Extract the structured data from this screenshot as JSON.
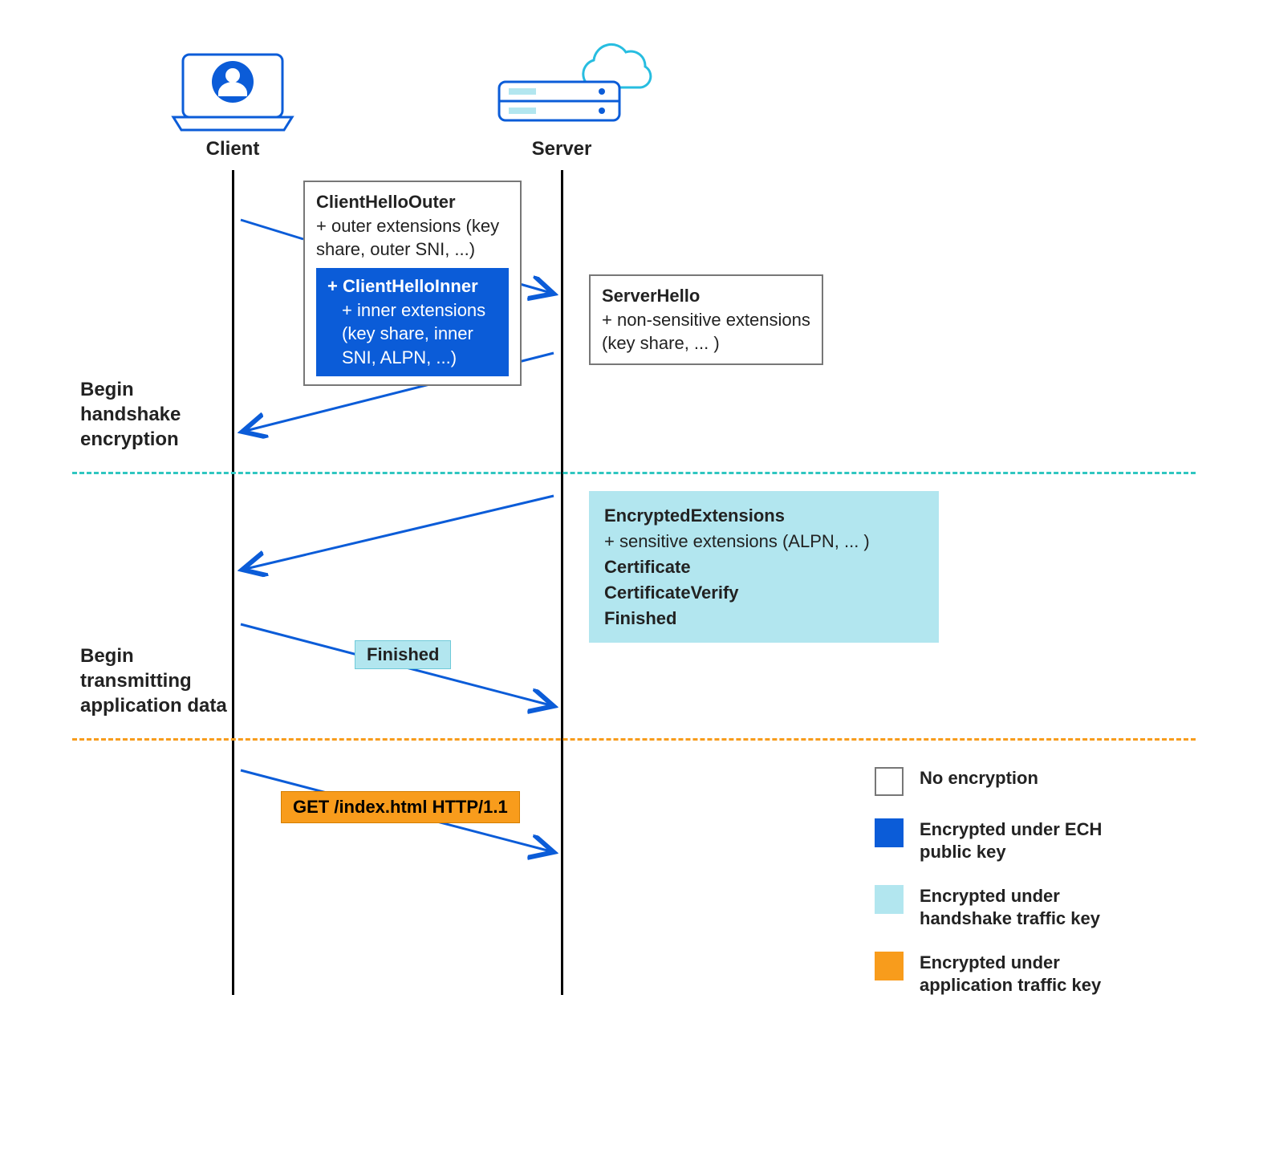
{
  "actors": {
    "client": "Client",
    "server": "Server"
  },
  "m1": {
    "title": "ClientHelloOuter",
    "detail": "+ outer extensions (key share, outer SNI, ...)",
    "inner_title": "+ ClientHelloInner",
    "inner_detail": "+ inner extensions (key share, inner SNI, ALPN, ...)"
  },
  "m2": {
    "title": "ServerHello",
    "detail": "+ non-sensitive extensions (key share, ... )"
  },
  "m3": {
    "l1": "EncryptedExtensions",
    "l2": "+ sensitive extensions (ALPN, ... )",
    "l3": "Certificate",
    "l4": "CertificateVerify",
    "l5": "Finished"
  },
  "m4": {
    "label": "Finished"
  },
  "m5": {
    "label": "GET /index.html HTTP/1.1"
  },
  "phase1": "Begin\nhandshake\nencryption",
  "phase2": "Begin\ntransmitting\napplication data",
  "legend": {
    "none": "No encryption",
    "ech": "Encrypted under ECH public key",
    "hsk": "Encrypted under handshake traffic key",
    "app": "Encrypted under application traffic key"
  },
  "colors": {
    "blue": "#0b5cd8",
    "hsk": "#b2e6ef",
    "orange": "#f89c1c",
    "teal_dash": "#2fc6c0",
    "orange_dash": "#f89c1c"
  }
}
